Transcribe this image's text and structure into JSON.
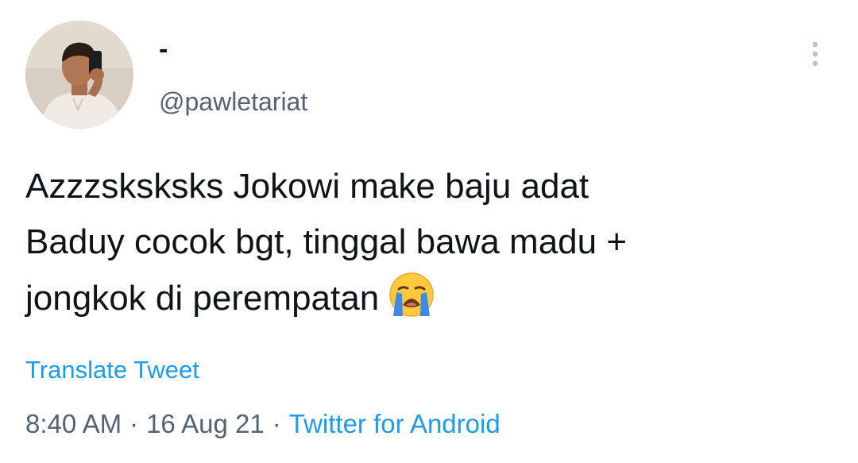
{
  "author": {
    "display_name": "-",
    "handle": "@pawletariat"
  },
  "menu": {
    "icon": "more-vertical-icon"
  },
  "tweet": {
    "lines": [
      "Azzzsksksks Jokowi make baju adat",
      "Baduy cocok bgt, tinggal bawa madu +",
      "jongkok di perempatan"
    ],
    "emoji": "loudly-crying-face-icon"
  },
  "translate_label": "Translate Tweet",
  "meta": {
    "time": "8:40 AM",
    "separator": "·",
    "date": "16 Aug 21",
    "source": "Twitter for Android"
  },
  "colors": {
    "text": "#0f1419",
    "secondary": "#536471",
    "link": "#1d9bf0"
  }
}
